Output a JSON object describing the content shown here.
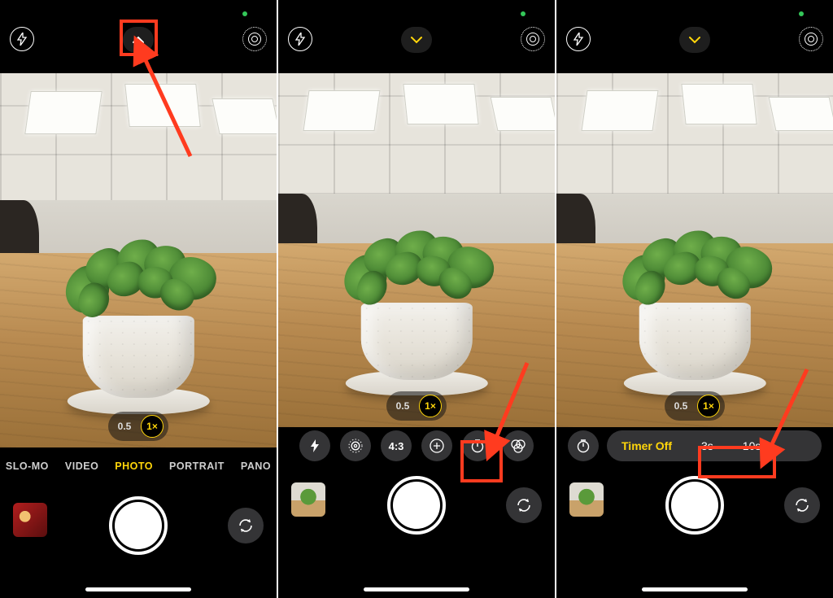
{
  "colors": {
    "accent": "#ffd60a",
    "annotation": "#ff3b1f"
  },
  "panel1": {
    "chevron_direction": "up",
    "chevron_color": "#ffffff",
    "zoom": {
      "options": [
        "0.5",
        "1×"
      ],
      "selected": "1×"
    },
    "modes": [
      "SLO-MO",
      "VIDEO",
      "PHOTO",
      "PORTRAIT",
      "PANO"
    ],
    "selected_mode": "PHOTO",
    "thumbnail": "last-photo-red"
  },
  "panel2": {
    "chevron_direction": "down",
    "chevron_color": "#ffd60a",
    "zoom": {
      "options": [
        "0.5",
        "1×"
      ],
      "selected": "1×"
    },
    "controls": {
      "c0_icon": "flash-icon",
      "c1_icon": "live-photo-icon",
      "c2_label": "4:3",
      "c3_icon": "exposure-icon",
      "c4_icon": "timer-icon",
      "c5_icon": "filters-icon"
    },
    "thumbnail": "last-photo-plant"
  },
  "panel3": {
    "chevron_direction": "down",
    "chevron_color": "#ffd60a",
    "zoom": {
      "options": [
        "0.5",
        "1×"
      ],
      "selected": "1×"
    },
    "timer": {
      "label": "Timer Off",
      "options": [
        "3s",
        "10s"
      ]
    },
    "thumbnail": "last-photo-plant"
  }
}
